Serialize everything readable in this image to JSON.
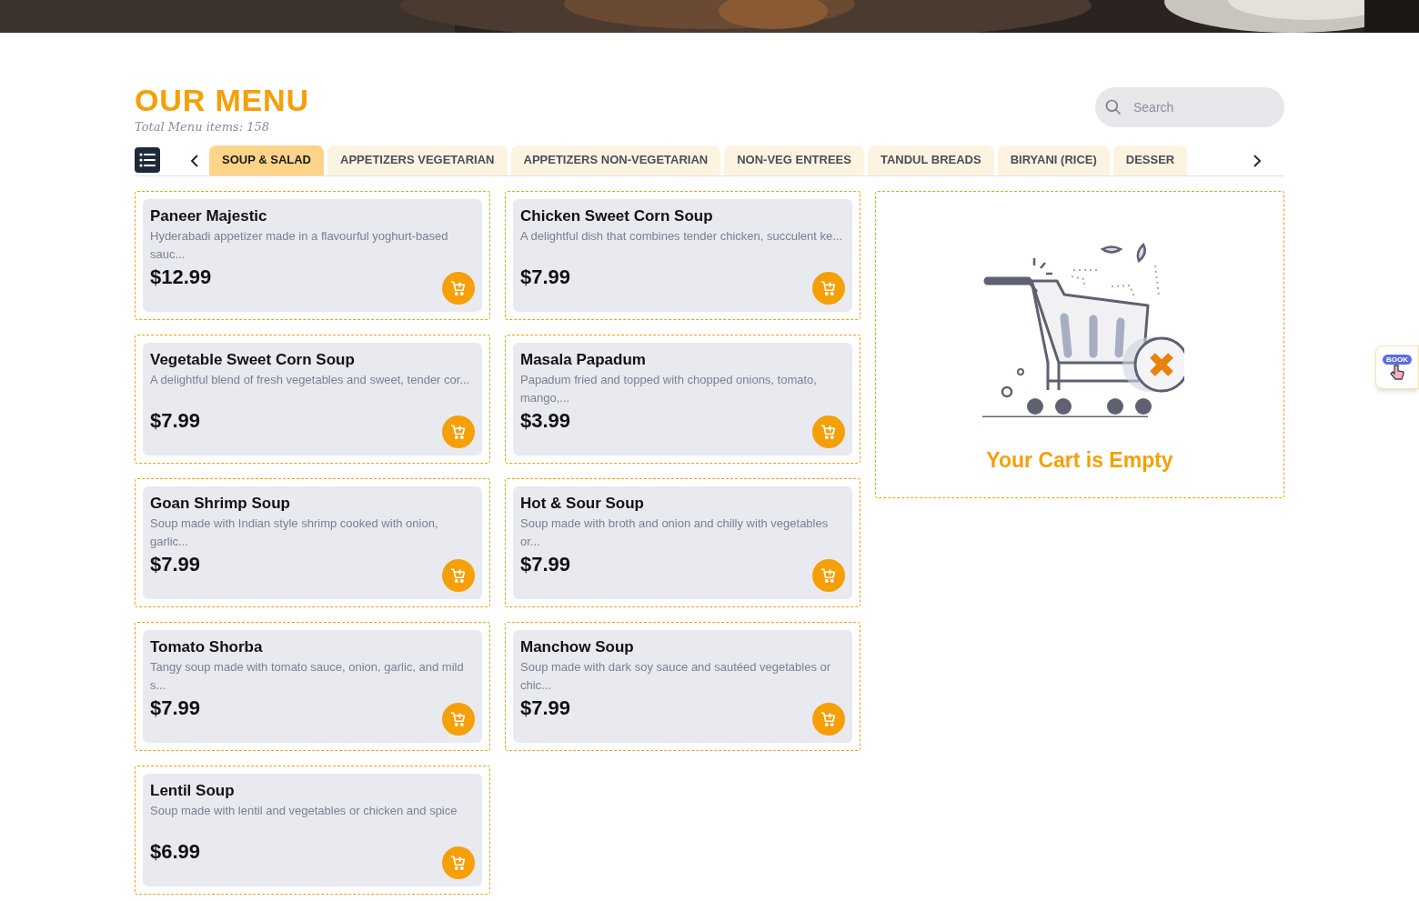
{
  "header": {
    "title": "OUR MENU",
    "subtitle": "Total Menu items: 158"
  },
  "search": {
    "placeholder": "Search"
  },
  "tabs": [
    {
      "label": "SOUP & SALAD",
      "selected": true
    },
    {
      "label": "APPETIZERS VEGETARIAN",
      "selected": false
    },
    {
      "label": "APPETIZERS NON-VEGETARIAN",
      "selected": false
    },
    {
      "label": "NON-VEG ENTREES",
      "selected": false
    },
    {
      "label": "TANDUL BREADS",
      "selected": false
    },
    {
      "label": "BIRYANI (RICE)",
      "selected": false
    },
    {
      "label": "DESSER",
      "selected": false
    }
  ],
  "items": [
    {
      "name": "Paneer Majestic",
      "description": "Hyderabadi appetizer made in a flavourful yoghurt-based sauc...",
      "price": "$12.99"
    },
    {
      "name": "Chicken Sweet Corn Soup",
      "description": "A delightful dish that combines tender chicken, succulent ke...",
      "price": "$7.99"
    },
    {
      "name": "Vegetable Sweet Corn Soup",
      "description": "A delightful blend of fresh vegetables and sweet, tender cor...",
      "price": "$7.99"
    },
    {
      "name": "Masala Papadum",
      "description": "Papadum fried and topped with chopped onions, tomato, mango,...",
      "price": "$3.99"
    },
    {
      "name": "Goan Shrimp Soup",
      "description": "Soup made with Indian style shrimp cooked with onion, garlic...",
      "price": "$7.99"
    },
    {
      "name": "Hot & Sour Soup",
      "description": "Soup made with broth and onion and chilly with vegetables or...",
      "price": "$7.99"
    },
    {
      "name": "Tomato Shorba",
      "description": "Tangy soup made with tomato sauce, onion, garlic, and mild s...",
      "price": "$7.99"
    },
    {
      "name": "Manchow Soup",
      "description": "Soup made with dark soy sauce and sautéed vegetables or chic...",
      "price": "$7.99"
    },
    {
      "name": "Lentil Soup",
      "description": "Soup made with lentil and vegetables or chicken and spice",
      "price": "$6.99"
    }
  ],
  "cart": {
    "message": "Your Cart is Empty"
  },
  "book_widget": {
    "label": "BOOK"
  }
}
